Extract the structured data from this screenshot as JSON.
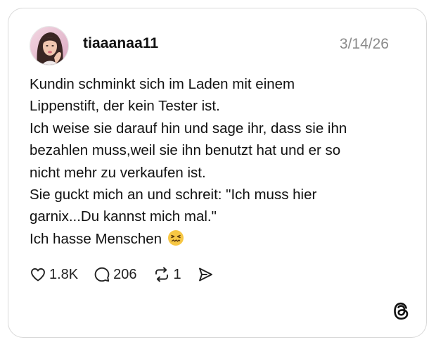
{
  "post": {
    "username": "tiaaanaa11",
    "date": "3/14/26",
    "text_lines": [
      "Kundin schminkt sich im Laden mit einem",
      "Lippenstift, der kein Tester ist.",
      "Ich weise sie darauf hin und sage ihr, dass sie ihn",
      "bezahlen muss,weil sie ihn benutzt hat und er so",
      "nicht mehr zu verkaufen ist.",
      "Sie guckt mich an und schreit: \"Ich muss hier",
      "garnix...Du kannst mich mal.\"",
      "Ich hasse Menschen"
    ],
    "emoji_icon": "confounded-face-emoji"
  },
  "actions": {
    "likes": "1.8K",
    "comments": "206",
    "reposts": "1"
  },
  "icons": {
    "like": "heart-icon",
    "comment": "comment-bubble-icon",
    "repost": "repost-icon",
    "share": "share-send-icon",
    "brand": "threads-logo-icon"
  },
  "colors": {
    "text": "#111111",
    "date": "#8a8a8a",
    "border": "#d9d9d9",
    "emoji_face": "#f7c744"
  }
}
